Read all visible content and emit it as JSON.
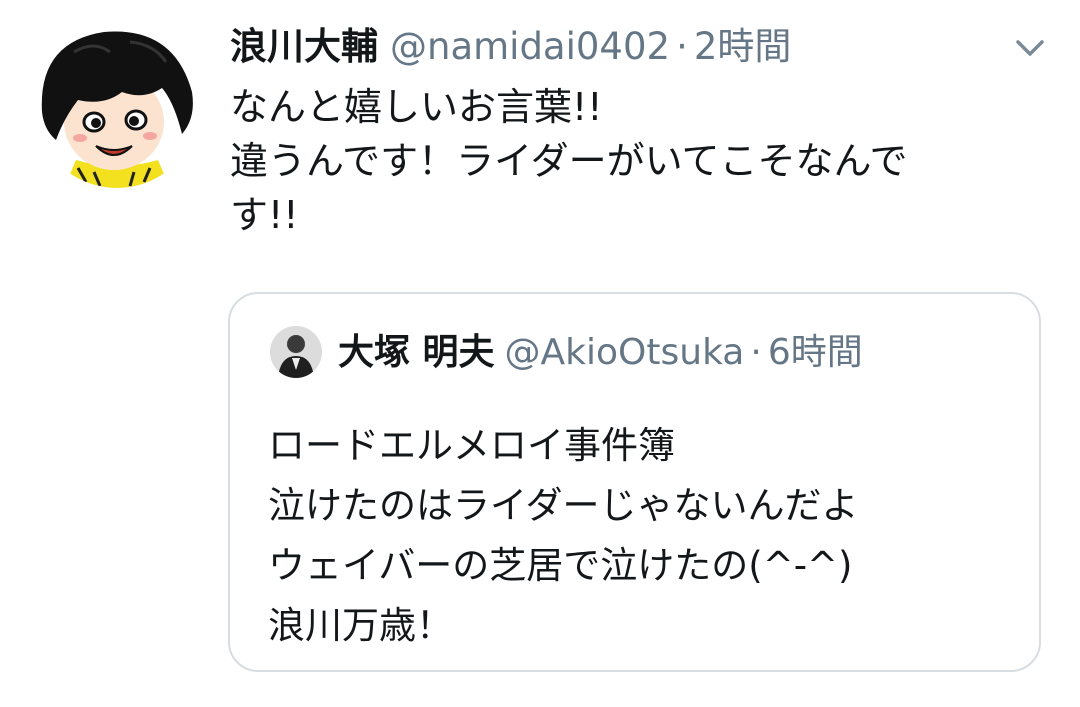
{
  "tweet": {
    "display_name": "浪川大輔",
    "handle": "@namidai0402",
    "separator": "·",
    "time": "2時間",
    "menu_icon": "chevron-down-icon",
    "avatar_icon": "profile-avatar",
    "text_lines": [
      "なんと嬉しいお言葉!!",
      "違うんです！ライダーがいてこそなんで",
      "す!!"
    ]
  },
  "quoted_tweet": {
    "display_name": "大塚 明夫",
    "handle": "@AkioOtsuka",
    "separator": "·",
    "time": "6時間",
    "avatar_icon": "profile-avatar",
    "text_lines": [
      "ロードエルメロイ事件簿",
      "泣けたのはライダーじゃないんだよ",
      "ウェイバーの芝居で泣けたの(^-^)",
      "浪川万歳！"
    ]
  },
  "colors": {
    "text_primary": "#14171a",
    "text_secondary": "#657786",
    "quote_border": "#d8dde1",
    "background": "#ffffff"
  }
}
